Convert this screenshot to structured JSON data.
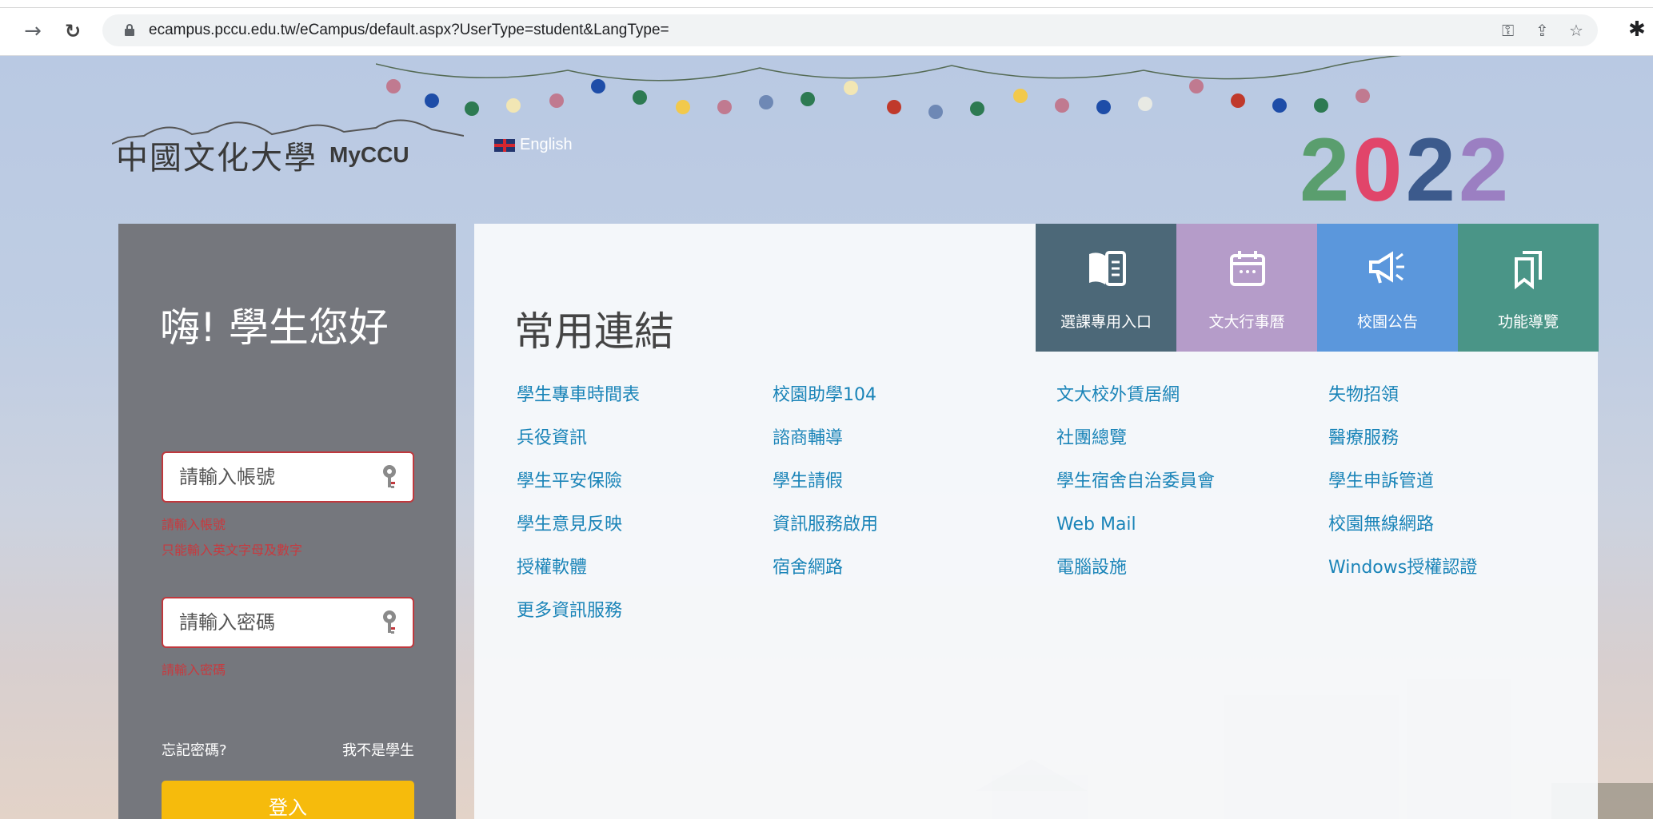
{
  "browser": {
    "url": "ecampus.pccu.edu.tw/eCampus/default.aspx?UserType=student&LangType="
  },
  "header": {
    "logo_zh": "中國文化大學",
    "logo_en": "MyCCU",
    "language_link": "English",
    "year_banner": "2022"
  },
  "login": {
    "greeting": "嗨! 學生您好",
    "account_placeholder": "請輸入帳號",
    "account_error_required": "請輸入帳號",
    "account_error_format": "只能輸入英文字母及數字",
    "password_placeholder": "請輸入密碼",
    "password_error_required": "請輸入密碼",
    "forgot_password": "忘記密碼?",
    "not_student": "我不是學生",
    "login_button": "登入"
  },
  "links": {
    "title": "常用連結",
    "tiles": [
      {
        "label": "選課專用入口",
        "icon": "book-icon"
      },
      {
        "label": "文大行事曆",
        "icon": "calendar-icon"
      },
      {
        "label": "校園公告",
        "icon": "megaphone-icon"
      },
      {
        "label": "功能導覽",
        "icon": "bookmark-icon"
      }
    ],
    "columns": [
      [
        "學生專車時間表",
        "兵役資訊",
        "學生平安保險",
        "學生意見反映",
        "授權軟體",
        "更多資訊服務"
      ],
      [
        "校園助學104",
        "諮商輔導",
        "學生請假",
        "資訊服務啟用",
        "宿舍網路"
      ],
      [
        "文大校外賃居網",
        "社團總覽",
        "學生宿舍自治委員會",
        "Web Mail",
        "電腦設施"
      ],
      [
        "失物招領",
        "醫療服務",
        "學生申訴管道",
        "校園無線網路",
        "Windows授權認證"
      ]
    ]
  },
  "colors": {
    "link": "#1a84b8",
    "login_panel": "#75777d",
    "login_button": "#f6bb0c",
    "error": "#c73a3f"
  }
}
